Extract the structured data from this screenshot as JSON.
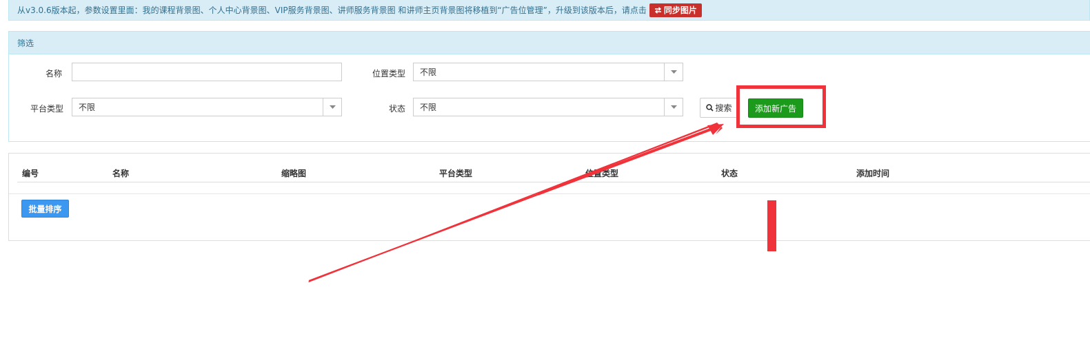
{
  "notice": {
    "text": "从v3.0.6版本起，参数设置里面：我的课程背景图、个人中心背景图、VIP服务背景图、讲师服务背景图 和讲师主页背景图将移植到“广告位管理”，升级到该版本后，请点击",
    "sync_label": "同步图片",
    "sync_icon": "exchange-icon"
  },
  "filter": {
    "heading": "筛选",
    "name_label": "名称",
    "name_value": "",
    "position_type_label": "位置类型",
    "position_type_value": "不限",
    "platform_type_label": "平台类型",
    "platform_type_value": "不限",
    "status_label": "状态",
    "status_value": "不限",
    "search_label": "搜索",
    "search_icon": "search-icon",
    "add_label": "添加新广告"
  },
  "table": {
    "columns": [
      "编号",
      "名称",
      "缩略图",
      "平台类型",
      "位置类型",
      "状态",
      "添加时间"
    ],
    "batch_sort_label": "批量排序"
  },
  "colors": {
    "annotation_red": "#f0323a",
    "add_button_green": "#1b9a1b",
    "batch_button_blue": "#3c97f0",
    "sync_button_red": "#c9302c",
    "info_bg": "#d9edf7"
  }
}
